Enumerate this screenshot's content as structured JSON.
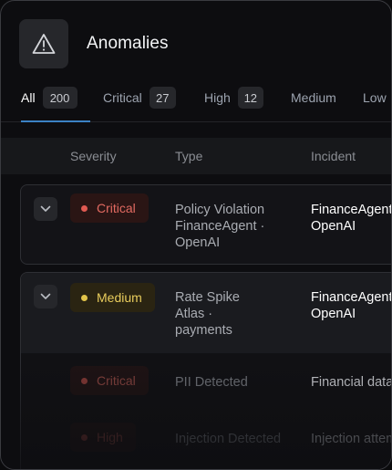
{
  "header": {
    "title": "Anomalies",
    "icon": "warning-triangle-icon"
  },
  "tabs": [
    {
      "label": "All",
      "count": "200",
      "active": true
    },
    {
      "label": "Critical",
      "count": "27"
    },
    {
      "label": "High",
      "count": "12"
    },
    {
      "label": "Medium",
      "count": ""
    },
    {
      "label": "Low",
      "count": ""
    }
  ],
  "columns": {
    "severity": "Severity",
    "type": "Type",
    "incident": "Incident"
  },
  "rows": [
    {
      "severity": "Critical",
      "type_lines": [
        "Policy Violation",
        "FinanceAgent ·",
        "OpenAI"
      ],
      "incident_lines": [
        "FinanceAgent",
        "OpenAI"
      ]
    },
    {
      "severity": "Medium",
      "type_lines": [
        "Rate Spike",
        "Atlas ·",
        "payments"
      ],
      "incident_lines": [
        "FinanceAgent",
        "OpenAI"
      ]
    },
    {
      "severity": "Critical",
      "type_lines": [
        "PII Detected"
      ],
      "incident_lines": [
        "Financial data"
      ]
    },
    {
      "severity": "High",
      "type_lines": [
        "Injection Detected"
      ],
      "incident_lines": [
        "Injection attempt"
      ]
    }
  ],
  "colors": {
    "accent": "#3b82c4",
    "critical": "#e05a52",
    "medium": "#e2c44a",
    "high": "#d0573f"
  }
}
